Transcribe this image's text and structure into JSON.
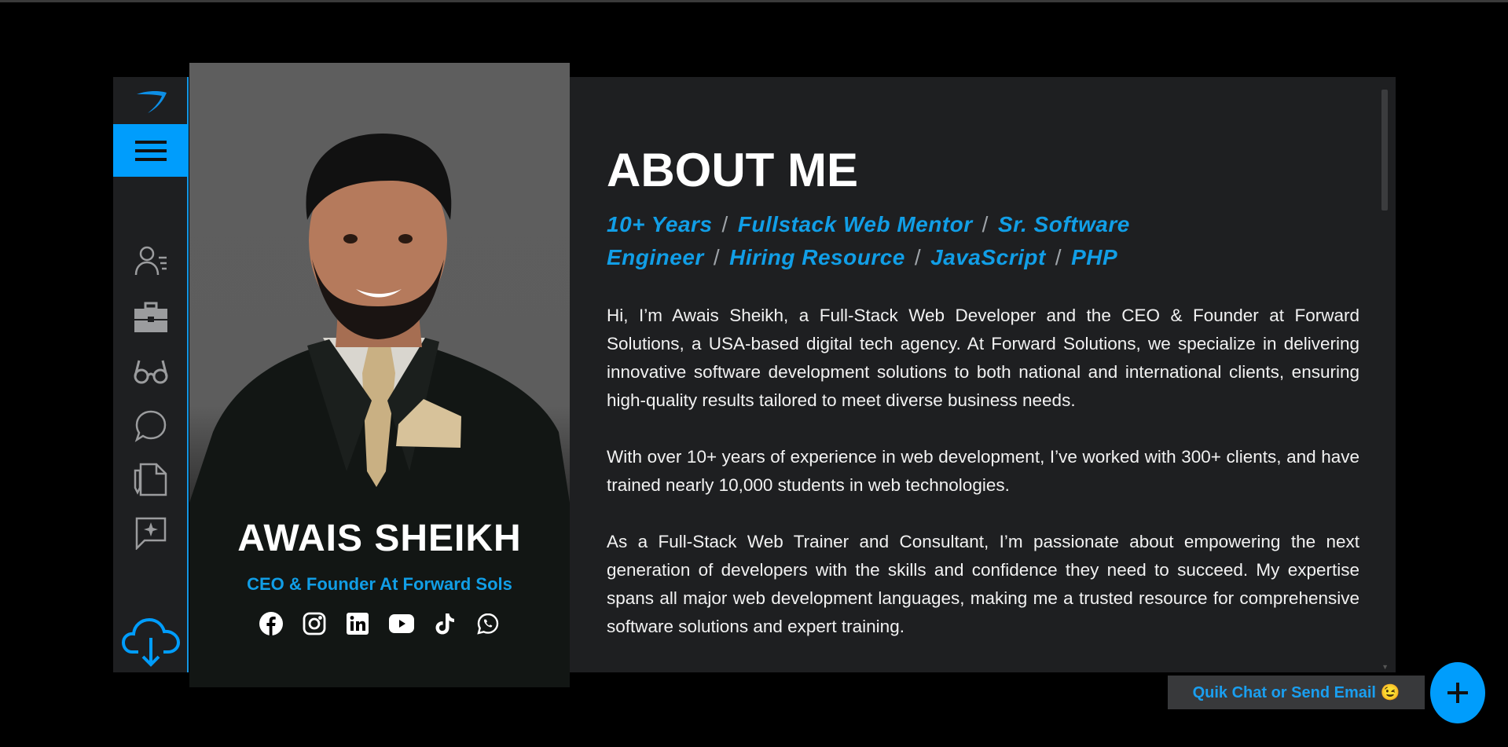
{
  "profile": {
    "name": "AWAIS SHEIKH",
    "role": "CEO & Founder At Forward Sols",
    "socials": [
      "facebook-icon",
      "instagram-icon",
      "linkedin-icon",
      "youtube-icon",
      "tiktok-icon",
      "whatsapp-icon"
    ]
  },
  "sidebar": {
    "items": [
      "about-icon",
      "portfolio-icon",
      "glasses-icon",
      "chat-icon",
      "resume-icon",
      "feedback-icon"
    ],
    "download": "cloud-download-icon"
  },
  "about": {
    "heading": "ABOUT ME",
    "tags": [
      "10+ Years",
      "Fullstack Web Mentor",
      "Sr. Software Engineer",
      "Hiring Resource",
      "JavaScript",
      "PHP"
    ],
    "separator": "/",
    "paragraphs": [
      "Hi, I’m Awais Sheikh, a Full-Stack Web Developer and the CEO & Founder at Forward Solutions, a USA-based digital tech agency. At Forward Solutions, we specialize in delivering innovative software development solutions to both national and international clients, ensuring high-quality results tailored to meet diverse business needs.",
      "With over 10+ years of experience in web development, I’ve worked with 300+ clients, and have trained nearly 10,000 students in web technologies.",
      "As a Full-Stack Web Trainer and Consultant, I’m passionate about empowering the next generation of developers with the skills and confidence they need to succeed. My expertise spans all major web development languages, making me a trusted resource for comprehensive software solutions and expert training."
    ]
  },
  "chat": {
    "label": "Quik Chat or Send Email 😉",
    "fab": "+"
  },
  "colors": {
    "accent": "#009dfc",
    "panel": "#1e1f21",
    "tag": "#119ee6"
  }
}
